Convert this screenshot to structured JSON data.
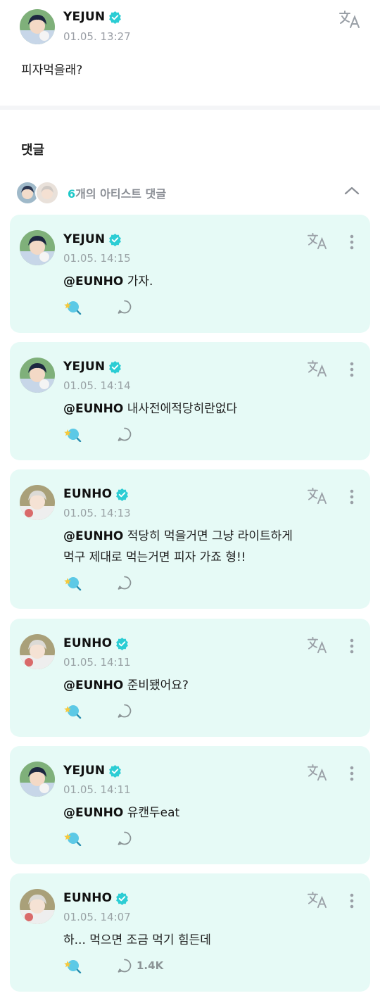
{
  "post": {
    "author": "YEJUN",
    "time": "01.05. 13:27",
    "body": "피자먹을래?"
  },
  "comments_section": {
    "title": "댓글",
    "artist_count": "6",
    "artist_label": "개의 아티스트 댓글"
  },
  "comments": [
    {
      "author": "YEJUN",
      "avatar": "yejun",
      "time": "01.05. 14:15",
      "mention": "@EUNHO",
      "lines": [
        "가자."
      ],
      "reply_count": ""
    },
    {
      "author": "YEJUN",
      "avatar": "yejun",
      "time": "01.05. 14:14",
      "mention": "@EUNHO",
      "lines": [
        "내사전에적당히란없다"
      ],
      "reply_count": ""
    },
    {
      "author": "EUNHO",
      "avatar": "eunho",
      "time": "01.05. 14:13",
      "mention": "@EUNHO",
      "lines": [
        "적당히 먹을거면 그냥 라이트하게",
        "먹구 제대로 먹는거면 피자 가죠 형!!"
      ],
      "reply_count": ""
    },
    {
      "author": "EUNHO",
      "avatar": "eunho",
      "time": "01.05. 14:11",
      "mention": "@EUNHO",
      "lines": [
        "준비됐어요?"
      ],
      "reply_count": ""
    },
    {
      "author": "YEJUN",
      "avatar": "yejun",
      "time": "01.05. 14:11",
      "mention": "@EUNHO",
      "lines": [
        "유캔두eat"
      ],
      "reply_count": ""
    },
    {
      "author": "EUNHO",
      "avatar": "eunho",
      "time": "01.05. 14:07",
      "mention": "",
      "lines": [
        "하... 먹으면 조금 먹기 힘든데"
      ],
      "reply_count": "1.4K"
    }
  ],
  "colors": {
    "card_background": "#e6faf6",
    "verified": "#2ccdd4",
    "accent": "#1cc8c8"
  },
  "icons": [
    "translate-icon",
    "more-icon",
    "cheer-icon",
    "reply-icon",
    "verified-icon",
    "chevron-up-icon"
  ]
}
